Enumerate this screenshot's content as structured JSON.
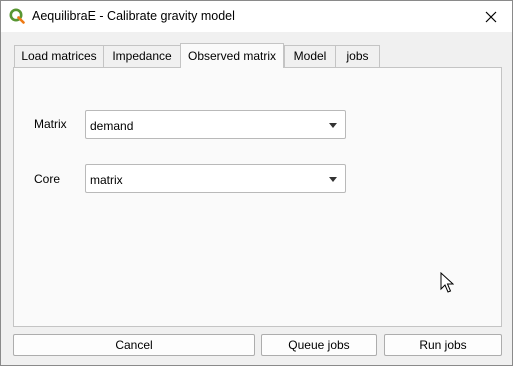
{
  "window": {
    "title": "AequilibraE - Calibrate gravity model",
    "icons": {
      "app": "qgis-logo-icon",
      "close": "close-icon",
      "cursor": "mouse-pointer-icon"
    }
  },
  "tabs": [
    {
      "label": "Load matrices",
      "active": false
    },
    {
      "label": "Impedance",
      "active": false
    },
    {
      "label": "Observed matrix",
      "active": true
    },
    {
      "label": "Model",
      "active": false
    },
    {
      "label": "jobs",
      "active": false
    }
  ],
  "observed_matrix": {
    "matrix_label": "Matrix",
    "matrix_value": "demand",
    "core_label": "Core",
    "core_value": "matrix"
  },
  "buttons": {
    "cancel": "Cancel",
    "queue_jobs": "Queue jobs",
    "run_jobs": "Run jobs"
  },
  "colors": {
    "qgis_green": "#589632",
    "qgis_yellow": "#ee7913"
  }
}
